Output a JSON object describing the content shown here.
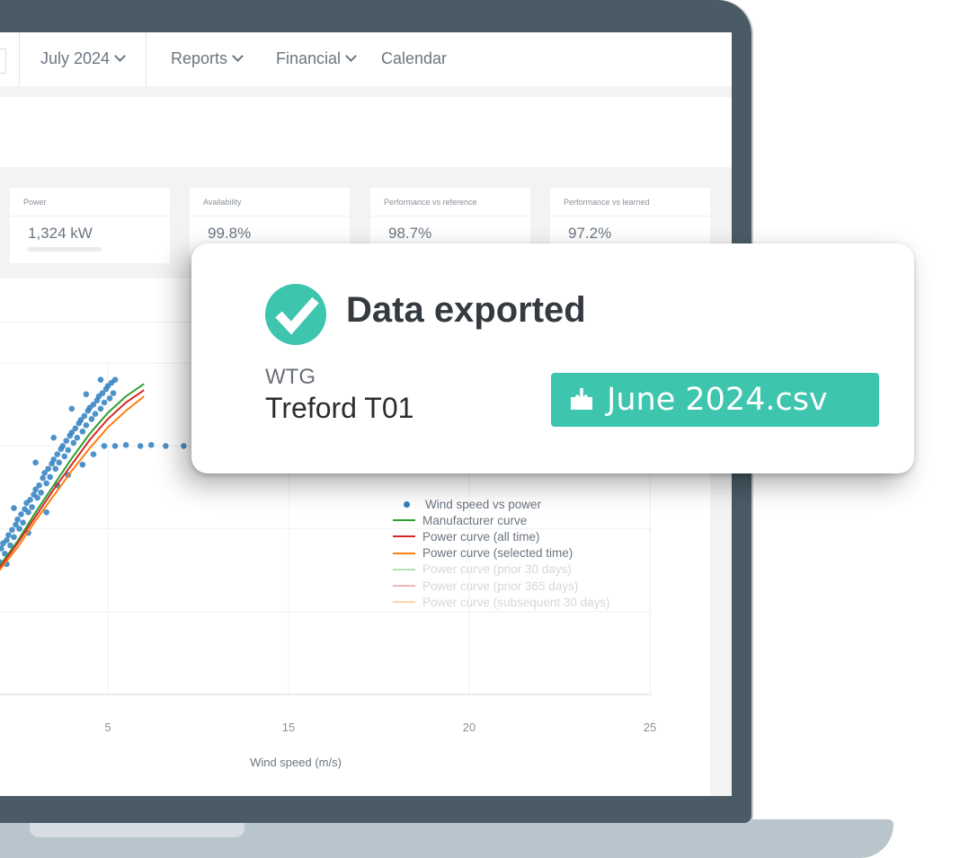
{
  "nav": {
    "items": [
      {
        "label": "July 2024",
        "dropdown": true
      },
      {
        "label": "Reports",
        "dropdown": true
      },
      {
        "label": "Financial",
        "dropdown": true
      },
      {
        "label": "Calendar",
        "dropdown": false
      }
    ]
  },
  "kpis": [
    {
      "label": "Power",
      "value": "1,324 kW"
    },
    {
      "label": "Availability",
      "value": "99.8%"
    },
    {
      "label": "Performance vs reference",
      "value": "98.7%"
    },
    {
      "label": "Performance vs learned",
      "value": "97.2%"
    }
  ],
  "toast": {
    "title": "Data exported",
    "asset_kind": "WTG",
    "asset_name": "Treford T01",
    "file_label": "June 2024.csv",
    "icon": "check-circle-icon",
    "file_icon": "download-tray-icon",
    "accent_color": "#3dc5ad"
  },
  "colors": {
    "frame": "#4a5b66",
    "base": "#b9c5cc",
    "points": "#2f7fc1"
  },
  "chart_data": {
    "type": "scatter",
    "title": "",
    "xlabel": "Wind speed (m/s)",
    "ylabel": "",
    "x_ticks": [
      {
        "value": 5,
        "label": "5"
      },
      {
        "value": 10,
        "label": "15"
      },
      {
        "value": 15,
        "label": "20"
      },
      {
        "value": 20,
        "label": "25"
      }
    ],
    "xlim": [
      0,
      20
    ],
    "ylim": [
      0,
      2000
    ],
    "y_gridlines": [
      400,
      800,
      1200,
      1600
    ],
    "grid": true,
    "legend_position": "right",
    "legend": [
      {
        "name": "Wind speed vs power",
        "type": "marker",
        "color": "#2f7fc1",
        "active": true
      },
      {
        "name": "Manufacturer curve",
        "type": "line",
        "color": "#2ca02c",
        "active": true
      },
      {
        "name": "Power curve (all time)",
        "type": "line",
        "color": "#d62728",
        "active": true
      },
      {
        "name": "Power curve (selected time)",
        "type": "line",
        "color": "#ff7f0e",
        "active": true
      },
      {
        "name": "Power curve (prior 30 days)",
        "type": "line",
        "color": "#2ca02c",
        "active": false
      },
      {
        "name": "Power curve (prior 365 days)",
        "type": "line",
        "color": "#d62728",
        "active": false
      },
      {
        "name": "Power curve (subsequent 30 days)",
        "type": "line",
        "color": "#ff7f0e",
        "active": false
      }
    ],
    "series": [
      {
        "name": "Manufacturer curve",
        "color": "#2ca02c",
        "x": [
          0,
          0.5,
          1,
          1.5,
          2,
          2.5,
          3,
          3.5,
          4,
          4.5,
          5,
          5.5,
          6
        ],
        "y": [
          330,
          380,
          440,
          520,
          620,
          740,
          880,
          1010,
          1140,
          1260,
          1360,
          1440,
          1500
        ]
      },
      {
        "name": "Power curve (all time)",
        "color": "#d62728",
        "x": [
          0,
          0.5,
          1,
          1.5,
          2,
          2.5,
          3,
          3.5,
          4,
          4.5,
          5,
          5.5,
          6
        ],
        "y": [
          340,
          390,
          440,
          510,
          610,
          730,
          860,
          990,
          1110,
          1230,
          1330,
          1410,
          1470
        ]
      },
      {
        "name": "Power curve (selected time)",
        "color": "#ff7f0e",
        "x": [
          0,
          0.5,
          1,
          1.5,
          2,
          2.5,
          3,
          3.5,
          4,
          4.5,
          5,
          5.5,
          6
        ],
        "y": [
          350,
          400,
          450,
          510,
          600,
          710,
          840,
          960,
          1080,
          1190,
          1290,
          1370,
          1440
        ]
      }
    ],
    "scatter": {
      "name": "Wind speed vs power",
      "points": [
        [
          0.05,
          330
        ],
        [
          0.2,
          360
        ],
        [
          0.3,
          390
        ],
        [
          0.45,
          420
        ],
        [
          0.55,
          410
        ],
        [
          0.6,
          470
        ],
        [
          0.7,
          440
        ],
        [
          0.8,
          455
        ],
        [
          0.9,
          490
        ],
        [
          1.0,
          430
        ],
        [
          1.05,
          520
        ],
        [
          1.1,
          480
        ],
        [
          1.15,
          500
        ],
        [
          1.2,
          545
        ],
        [
          1.3,
          530
        ],
        [
          1.4,
          565
        ],
        [
          1.45,
          520
        ],
        [
          1.5,
          595
        ],
        [
          1.55,
          580
        ],
        [
          1.6,
          555
        ],
        [
          1.7,
          610
        ],
        [
          1.75,
          640
        ],
        [
          1.8,
          600
        ],
        [
          1.85,
          660
        ],
        [
          1.9,
          690
        ],
        [
          2.0,
          640
        ],
        [
          2.05,
          705
        ],
        [
          2.1,
          730
        ],
        [
          2.15,
          680
        ],
        [
          2.2,
          745
        ],
        [
          2.25,
          770
        ],
        [
          2.3,
          720
        ],
        [
          2.35,
          795
        ],
        [
          2.4,
          760
        ],
        [
          2.45,
          820
        ],
        [
          2.5,
          845
        ],
        [
          2.55,
          800
        ],
        [
          2.6,
          870
        ],
        [
          2.65,
          830
        ],
        [
          2.7,
          895
        ],
        [
          2.75,
          925
        ],
        [
          2.8,
          880
        ],
        [
          2.85,
          940
        ],
        [
          2.9,
          905
        ],
        [
          2.95,
          965
        ],
        [
          3.0,
          990
        ],
        [
          3.05,
          950
        ],
        [
          3.1,
          1010
        ],
        [
          3.15,
          975
        ],
        [
          3.2,
          1045
        ],
        [
          3.25,
          1070
        ],
        [
          3.3,
          1020
        ],
        [
          3.35,
          1090
        ],
        [
          3.4,
          1050
        ],
        [
          3.45,
          1115
        ],
        [
          3.5,
          1135
        ],
        [
          3.55,
          1090
        ],
        [
          3.6,
          1160
        ],
        [
          3.65,
          1120
        ],
        [
          3.7,
          1185
        ],
        [
          3.75,
          1200
        ],
        [
          3.8,
          1150
        ],
        [
          3.85,
          1225
        ],
        [
          3.9,
          1180
        ],
        [
          3.95,
          1250
        ],
        [
          4.0,
          1265
        ],
        [
          4.05,
          1215
        ],
        [
          4.1,
          1285
        ],
        [
          4.15,
          1240
        ],
        [
          4.2,
          1310
        ],
        [
          4.25,
          1325
        ],
        [
          4.3,
          1270
        ],
        [
          4.35,
          1345
        ],
        [
          4.4,
          1300
        ],
        [
          4.45,
          1370
        ],
        [
          4.5,
          1385
        ],
        [
          4.55,
          1330
        ],
        [
          4.6,
          1400
        ],
        [
          4.65,
          1355
        ],
        [
          4.7,
          1420
        ],
        [
          4.75,
          1440
        ],
        [
          4.8,
          1380
        ],
        [
          4.85,
          1455
        ],
        [
          4.9,
          1410
        ],
        [
          4.95,
          1475
        ],
        [
          5.0,
          1490
        ],
        [
          5.05,
          1430
        ],
        [
          5.1,
          1505
        ],
        [
          5.15,
          1455
        ],
        [
          5.2,
          1520
        ],
        [
          1.2,
          420
        ],
        [
          1.6,
          690
        ],
        [
          2.2,
          630
        ],
        [
          2.8,
          780
        ],
        [
          3.3,
          880
        ],
        [
          3.6,
          1010
        ],
        [
          3.9,
          1060
        ],
        [
          4.3,
          1110
        ],
        [
          4.6,
          1160
        ],
        [
          4.9,
          1200
        ],
        [
          5.2,
          1200
        ],
        [
          5.5,
          1205
        ],
        [
          5.9,
          1200
        ],
        [
          6.2,
          1205
        ],
        [
          6.6,
          1200
        ],
        [
          7.1,
          1200
        ],
        [
          7.4,
          1200
        ],
        [
          7.9,
          1200
        ],
        [
          8.2,
          1200
        ],
        [
          8.6,
          1200
        ],
        [
          9.1,
          1200
        ],
        [
          9.6,
          1200
        ],
        [
          10.2,
          1200
        ],
        [
          11.0,
          1200
        ],
        [
          11.3,
          1200
        ],
        [
          11.9,
          1200
        ],
        [
          12.2,
          1200
        ],
        [
          12.4,
          1200
        ],
        [
          12.9,
          1200
        ],
        [
          13.5,
          1200
        ],
        [
          14.2,
          1200
        ],
        [
          0.5,
          540
        ],
        [
          0.9,
          600
        ],
        [
          1.4,
          620
        ],
        [
          2.4,
          900
        ],
        [
          3.0,
          1120
        ],
        [
          3.5,
          1240
        ],
        [
          4.0,
          1380
        ],
        [
          4.4,
          1450
        ],
        [
          4.8,
          1520
        ]
      ]
    }
  }
}
